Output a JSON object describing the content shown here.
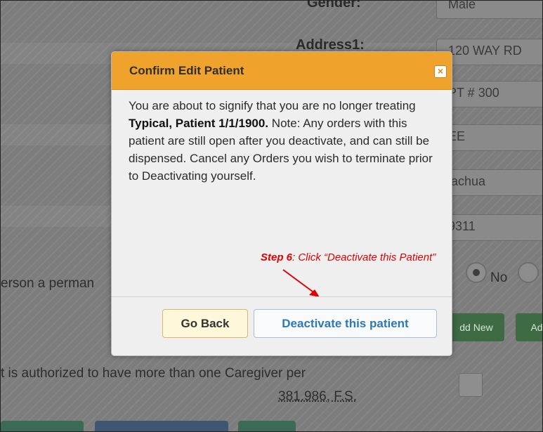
{
  "form": {
    "gender_label": "Gender:",
    "gender_value": "Male",
    "address1_label": "Address1:",
    "address1_value": "120 WAY RD",
    "address2_value": "PT # 300",
    "city_value": "EE",
    "county_value": "lachua",
    "zip_value": "9311",
    "permanent_question": "erson a perman",
    "radio_no_label": "No",
    "add_new_label": "dd New",
    "add_label": "Ad",
    "caregiver_question": "t is authorized to have more than one Caregiver per",
    "caregiver_statute": "381.986, F.S."
  },
  "modal": {
    "title": "Confirm Edit Patient",
    "close_glyph": "×",
    "message_intro": "You are about to signify that you are no longer treating ",
    "patient_name": "Typical, Patient 1/1/1900.",
    "message_rest": " Note: Any orders with this patient are still open after you deactivate, and can still be dispensed. Cancel any Orders you wish to terminate prior to Deactivating yourself.",
    "go_back_label": "Go Back",
    "deactivate_label": "Deactivate this patient"
  },
  "annotation": {
    "step_label": "Step 6",
    "step_text": ": Click “Deactivate this Patient”",
    "color": "#e00000"
  },
  "colors": {
    "modal_header": "#f0a32c",
    "overlay": "#7d7d7d",
    "deactivate_text": "#2e78b8"
  }
}
